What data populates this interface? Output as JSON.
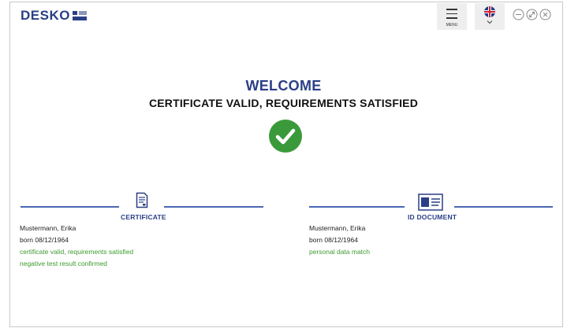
{
  "header": {
    "logo_text": "DESKO",
    "menu_label": "MENU",
    "language_flag": "uk-flag-icon",
    "window_controls": [
      "minimize-icon",
      "resize-icon",
      "close-icon"
    ]
  },
  "main": {
    "welcome": "WELCOME",
    "status": "CERTIFICATE VALID, REQUIREMENTS SATISFIED",
    "status_icon": "check-circle-icon"
  },
  "certificate": {
    "title": "CERTIFICATE",
    "icon": "certificate-document-icon",
    "name": "Mustermann, Erika",
    "born": "born 08/12/1964",
    "notes": [
      "certificate valid, requirements satisfied",
      "negative test result confirmed"
    ]
  },
  "id_document": {
    "title": "ID DOCUMENT",
    "icon": "id-card-icon",
    "name": "Mustermann, Erika",
    "born": "born 08/12/1964",
    "notes": [
      "personal data match"
    ]
  },
  "colors": {
    "brand": "#2a3f86",
    "accent_line": "#4a67b4",
    "success": "#3c9a2e",
    "check_fill": "#3a9a3a"
  }
}
